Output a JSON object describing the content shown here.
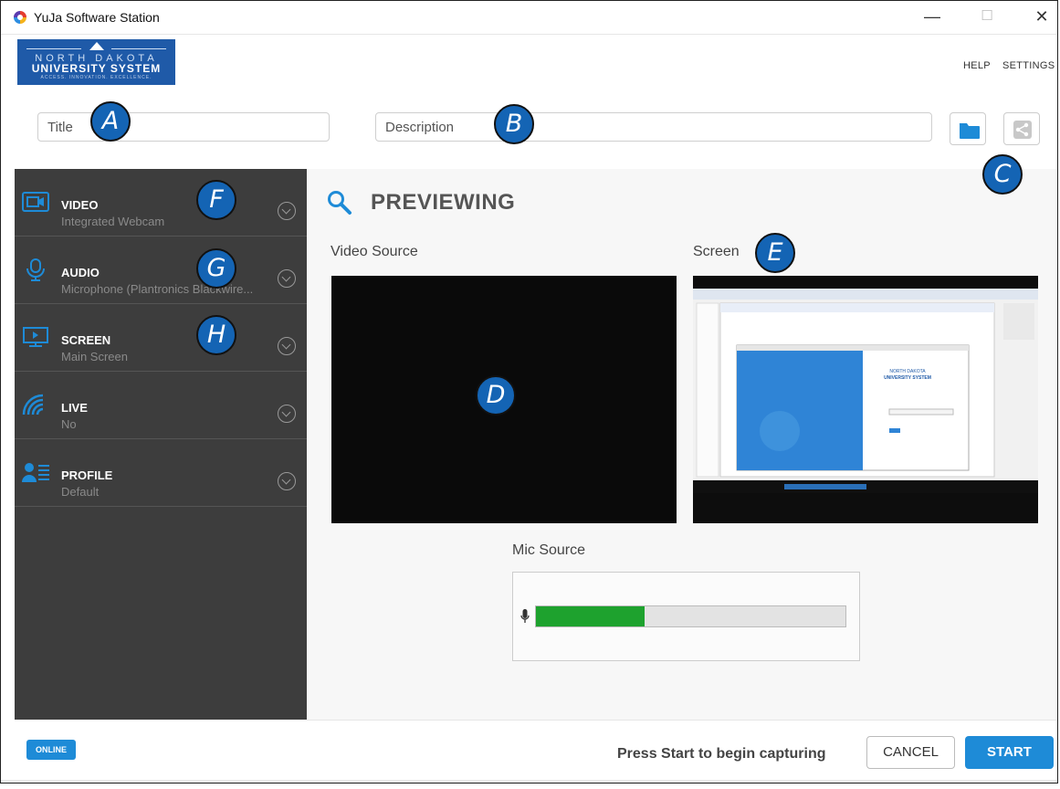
{
  "window": {
    "title": "YuJa Software Station",
    "minimize_glyph": "—",
    "maximize_glyph": "☐",
    "close_glyph": "✕"
  },
  "logo": {
    "line1": "NORTH DAKOTA",
    "line2": "UNIVERSITY SYSTEM",
    "line3": "ACCESS. INNOVATION. EXCELLENCE."
  },
  "header": {
    "help": "HELP",
    "settings": "SETTINGS"
  },
  "fields": {
    "title_placeholder": "Title",
    "description_placeholder": "Description"
  },
  "sidebar": {
    "items": [
      {
        "label": "VIDEO",
        "value": "Integrated Webcam",
        "icon": "webcam-icon"
      },
      {
        "label": "AUDIO",
        "value": "Microphone (Plantronics Blackwire...",
        "icon": "microphone-icon"
      },
      {
        "label": "SCREEN",
        "value": "Main Screen",
        "icon": "screen-icon"
      },
      {
        "label": "LIVE",
        "value": "No",
        "icon": "live-broadcast-icon"
      },
      {
        "label": "PROFILE",
        "value": "Default",
        "icon": "profile-icon"
      }
    ],
    "status": "ONLINE"
  },
  "main": {
    "heading": "PREVIEWING",
    "video_source_label": "Video Source",
    "screen_label": "Screen",
    "mic_source_label": "Mic Source",
    "mic_level": 0.35
  },
  "footer": {
    "prompt": "Press Start to begin capturing",
    "cancel": "CANCEL",
    "start": "START"
  },
  "markers": {
    "a": "A",
    "b": "B",
    "c": "C",
    "d": "D",
    "e": "E",
    "f": "F",
    "g": "G",
    "h": "H"
  },
  "colors": {
    "accent": "#1e8bd7",
    "sidebar_bg": "#3d3d3d",
    "meter_green": "#1ea22e",
    "marker_blue": "#1464b4"
  }
}
